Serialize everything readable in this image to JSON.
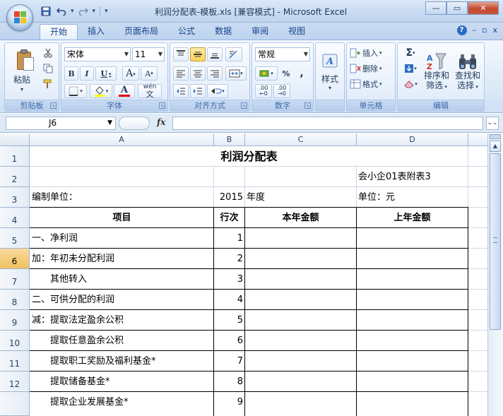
{
  "window": {
    "title": "利润分配表-模板.xls  [兼容模式] - Microsoft Excel",
    "minimize": "—",
    "maximize": "▭",
    "close": "✕"
  },
  "qat": {
    "save_icon": "save-icon",
    "undo_icon": "undo-icon",
    "redo_icon": "redo-icon"
  },
  "tabs": [
    {
      "label": "开始",
      "active": true
    },
    {
      "label": "插入"
    },
    {
      "label": "页面布局"
    },
    {
      "label": "公式"
    },
    {
      "label": "数据"
    },
    {
      "label": "审阅"
    },
    {
      "label": "视图"
    }
  ],
  "tab_right": {
    "help": "?",
    "min": "–",
    "restore": "▫",
    "close": "x"
  },
  "ribbon": {
    "clipboard": {
      "label": "剪贴板",
      "paste": "粘贴"
    },
    "font": {
      "label": "字体",
      "font_name": "宋体",
      "font_size": "11",
      "bold": "B",
      "italic": "I",
      "underline": "U",
      "grow": "A",
      "shrink": "A",
      "color_a": "A",
      "phonetic": "wén"
    },
    "alignment": {
      "label": "对齐方式"
    },
    "number": {
      "label": "数字",
      "format": "常规",
      "percent": "%",
      "comma": ",",
      "inc_decimal": ".00",
      "dec_decimal": ".00"
    },
    "styles": {
      "label": "样式"
    },
    "cells": {
      "label": "单元格",
      "insert": "插入",
      "delete": "删除",
      "format": "格式"
    },
    "editing": {
      "label": "编辑",
      "sum": "Σ",
      "sort": "排序和",
      "sort2": "筛选",
      "find": "查找和",
      "find2": "选择"
    }
  },
  "formula_bar": {
    "name_box": "J6",
    "fx": "fx",
    "content": ""
  },
  "grid": {
    "columns": [
      "A",
      "B",
      "C",
      "D"
    ],
    "rows": [
      "1",
      "2",
      "3",
      "4",
      "5",
      "6",
      "7",
      "8",
      "9",
      "10",
      "11",
      "12"
    ],
    "active_row": "6",
    "title": "利润分配表",
    "subtitle_form": "会小企01表附表3",
    "unit_label": "编制单位：",
    "year_value": "2015",
    "year_label": "年度",
    "currency": "单位：元",
    "headers": {
      "item": "项目",
      "line": "行次",
      "current": "本年金额",
      "prior": "上年金额"
    },
    "items": [
      {
        "label": "一、净利润",
        "line": "1"
      },
      {
        "label": "加：年初未分配利润",
        "line": "2"
      },
      {
        "label": "　　其他转入",
        "line": "3"
      },
      {
        "label": "二、可供分配的利润",
        "line": "4"
      },
      {
        "label": "减：提取法定盈余公积",
        "line": "5"
      },
      {
        "label": "　　提取任意盈余公积",
        "line": "6"
      },
      {
        "label": "　　提取职工奖励及福利基金*",
        "line": "7"
      },
      {
        "label": "　　提取储备基金*",
        "line": "8"
      },
      {
        "label": "　　提取企业发展基金*",
        "line": "9"
      }
    ]
  }
}
